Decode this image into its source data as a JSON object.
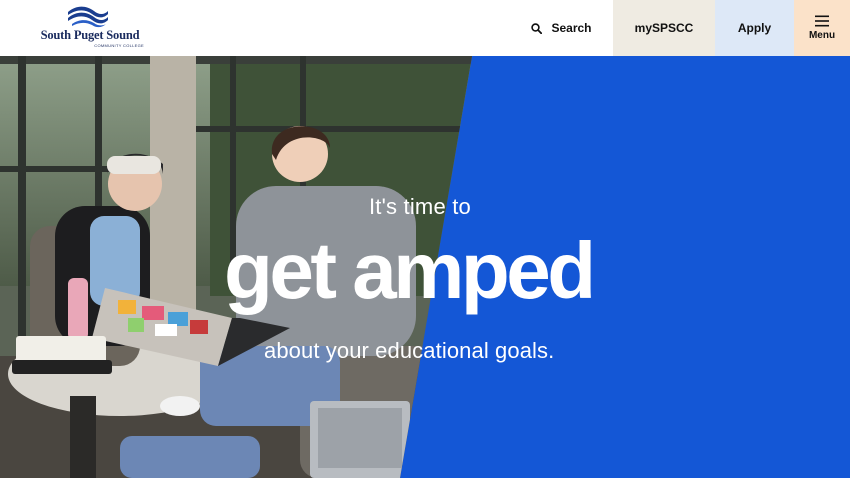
{
  "header": {
    "logo": {
      "name": "South Puget Sound",
      "subtitle": "COMMUNITY COLLEGE"
    },
    "search": {
      "label": "Search",
      "icon": "search-icon"
    },
    "nav": {
      "myspscc_label": "mySPSCC",
      "apply_label": "Apply",
      "menu_label": "Menu",
      "menu_icon": "hamburger-icon"
    }
  },
  "hero": {
    "intro": "It's time to",
    "headline": "get amped",
    "subline": "about your educational goals."
  },
  "colors": {
    "brand_navy": "#1a2b5e",
    "hero_blue": "#1457d6",
    "myspscc_bg": "#efebe2",
    "apply_bg": "#dde8f7",
    "menu_bg": "#fbe2c9"
  }
}
